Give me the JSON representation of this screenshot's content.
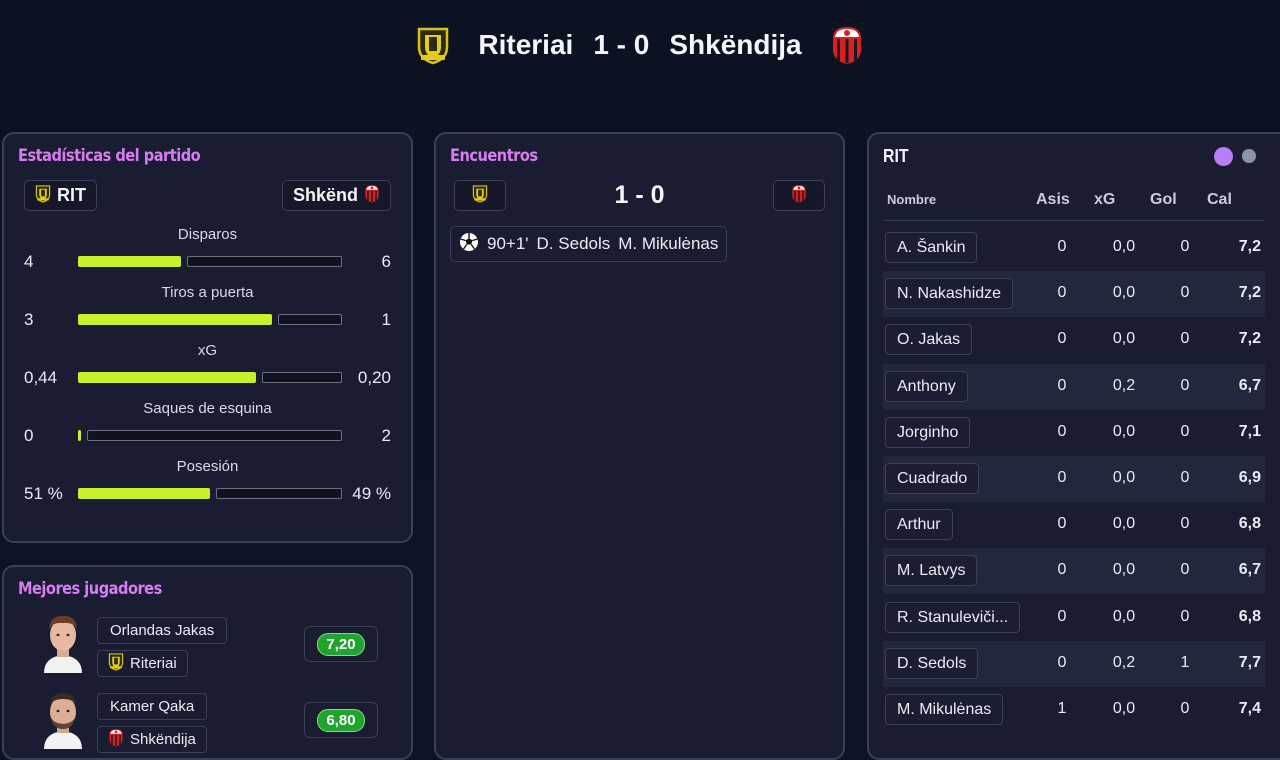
{
  "header": {
    "home_team": "Riteriai",
    "score": "1 - 0",
    "away_team": "Shkëndija"
  },
  "colors": {
    "accent_title": "#d77cf2",
    "bar_home": "#c8f12d",
    "rating_green": "#21a32f"
  },
  "stats_panel": {
    "title": "Estadísticas del partido",
    "home_abbr": "RIT",
    "away_abbr": "Shkënd",
    "rows": [
      {
        "label": "Disparos",
        "home": "4",
        "away": "6",
        "home_fraction": 0.4
      },
      {
        "label": "Tiros a puerta",
        "home": "3",
        "away": "1",
        "home_fraction": 0.75
      },
      {
        "label": "xG",
        "home": "0,44",
        "away": "0,20",
        "home_fraction": 0.69
      },
      {
        "label": "Saques de esquina",
        "home": "0",
        "away": "2",
        "home_fraction": 0.0
      },
      {
        "label": "Posesión",
        "home": "51 %",
        "away": "49 %",
        "home_fraction": 0.51
      }
    ]
  },
  "best_players": {
    "title": "Mejores jugadores",
    "players": [
      {
        "name": "Orlandas Jakas",
        "team": "Riteriai",
        "rating": "7,20",
        "crest": "riteriai-crest-icon"
      },
      {
        "name": "Kamer Qaka",
        "team": "Shkëndija",
        "rating": "6,80",
        "crest": "shkendija-crest-icon"
      }
    ]
  },
  "encounters": {
    "title": "Encuentros",
    "score": "1 - 0",
    "events": [
      {
        "icon": "soccer-ball-icon",
        "minute": "90+1'",
        "scorer": "D. Sedols",
        "assist": "M. Mikulėnas"
      }
    ]
  },
  "lineup": {
    "title": "RIT",
    "columns": {
      "name": "Nombre",
      "asis": "Asis",
      "xg": "xG",
      "gol": "Gol",
      "cal": "Cal"
    },
    "rows": [
      {
        "name": "A. Šankin",
        "asis": "0",
        "xg": "0,0",
        "gol": "0",
        "cal": "7,2"
      },
      {
        "name": "N. Nakashidze",
        "asis": "0",
        "xg": "0,0",
        "gol": "0",
        "cal": "7,2"
      },
      {
        "name": "O. Jakas",
        "asis": "0",
        "xg": "0,0",
        "gol": "0",
        "cal": "7,2"
      },
      {
        "name": "Anthony",
        "asis": "0",
        "xg": "0,2",
        "gol": "0",
        "cal": "6,7"
      },
      {
        "name": "Jorginho",
        "asis": "0",
        "xg": "0,0",
        "gol": "0",
        "cal": "7,1"
      },
      {
        "name": "Cuadrado",
        "asis": "0",
        "xg": "0,0",
        "gol": "0",
        "cal": "6,9"
      },
      {
        "name": "Arthur",
        "asis": "0",
        "xg": "0,0",
        "gol": "0",
        "cal": "6,8"
      },
      {
        "name": "M. Latvys",
        "asis": "0",
        "xg": "0,0",
        "gol": "0",
        "cal": "6,7"
      },
      {
        "name": "R. Stanuleviči...",
        "asis": "0",
        "xg": "0,0",
        "gol": "0",
        "cal": "6,8"
      },
      {
        "name": "D. Sedols",
        "asis": "0",
        "xg": "0,2",
        "gol": "1",
        "cal": "7,7"
      },
      {
        "name": "M. Mikulėnas",
        "asis": "1",
        "xg": "0,0",
        "gol": "0",
        "cal": "7,4"
      }
    ]
  }
}
